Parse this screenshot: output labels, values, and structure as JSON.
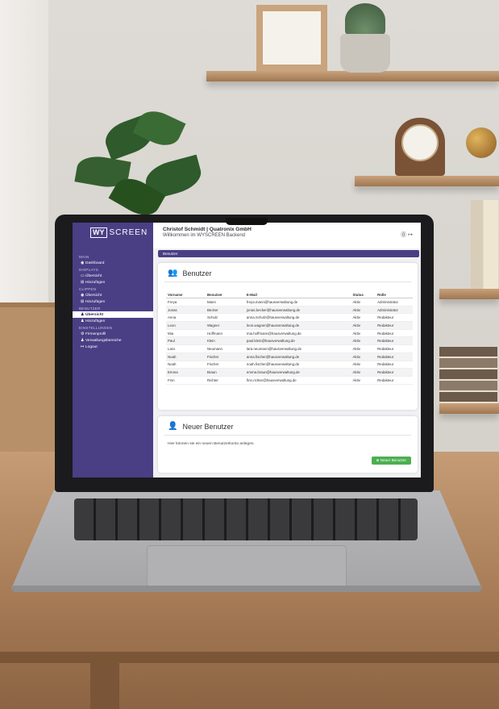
{
  "app": {
    "logo_box": "WY",
    "logo_rest": "SCREEN",
    "title": "Christof Schmidt | Quatronix GmbH",
    "subtitle": "Willkommen im WYSCREEN Backend"
  },
  "topbar": {
    "help_icon": "help-circle-icon",
    "logout_icon": "logout-icon"
  },
  "sidebar": {
    "sections": [
      {
        "label": "MAIN",
        "items": [
          {
            "icon": "dashboard-icon",
            "label": "Dashboard"
          }
        ]
      },
      {
        "label": "DISPLAYS",
        "items": [
          {
            "icon": "monitor-icon",
            "label": "Übersicht"
          },
          {
            "icon": "plus-square-icon",
            "label": "Hinzufügen"
          }
        ]
      },
      {
        "label": "CLIPPEN",
        "items": [
          {
            "icon": "clip-icon",
            "label": "Übersicht"
          },
          {
            "icon": "plus-square-icon",
            "label": "Hinzufügen"
          }
        ]
      },
      {
        "label": "BENUTZER",
        "items": [
          {
            "icon": "user-icon",
            "label": "Übersicht",
            "active": true
          },
          {
            "icon": "user-plus-icon",
            "label": "Hinzufügen"
          }
        ]
      },
      {
        "label": "EINSTELLUNGEN",
        "items": [
          {
            "icon": "gear-icon",
            "label": "Firmenprofil"
          },
          {
            "icon": "users-icon",
            "label": "Verwaltungsbereiche"
          },
          {
            "icon": "logout-icon",
            "label": "Logout"
          }
        ]
      }
    ]
  },
  "breadcrumb": "Benutzer",
  "users": {
    "heading": "Benutzer",
    "columns": [
      "Vorname",
      "Benutzer",
      "E-Mail",
      "Status",
      "Rolle"
    ],
    "rows": [
      [
        "Freya",
        "Mann",
        "freya.mann@hausverwaltung.de",
        "Aktiv",
        "Administrator"
      ],
      [
        "Jonas",
        "Becker",
        "jonas.becker@hausverwaltung.de",
        "Aktiv",
        "Administrator"
      ],
      [
        "Anna",
        "Schulz",
        "anna.Schulz@hausverwaltung.de",
        "Aktiv",
        "Redakteur"
      ],
      [
        "Leon",
        "Wagner",
        "leon.wagner@hausverwaltung.de",
        "Aktiv",
        "Redakteur"
      ],
      [
        "Mia",
        "Hoffmann",
        "mia.hoffmann@hausverwaltung.de",
        "Aktiv",
        "Redakteur"
      ],
      [
        "Paul",
        "Klein",
        "paul.klein@hausverwaltung.de",
        "Aktiv",
        "Redakteur"
      ],
      [
        "Lara",
        "Neumann",
        "lara.neumann@hausverwaltung.de",
        "Aktiv",
        "Redakteur"
      ],
      [
        "Noah",
        "Fischer",
        "anna.fischer@hausverwaltung.de",
        "Aktiv",
        "Redakteur"
      ],
      [
        "Noah",
        "Fischer",
        "noah.fischer@hausverwaltung.de",
        "Aktiv",
        "Redakteur"
      ],
      [
        "Emma",
        "Braun",
        "emma.braun@hausverwaltung.de",
        "Aktiv",
        "Redakteur"
      ],
      [
        "Finn",
        "Richter",
        "finn.richter@hausverwaltung.de",
        "Aktiv",
        "Redakteur"
      ]
    ]
  },
  "new_user": {
    "heading": "Neuer Benutzer",
    "text": "Hier können sie ein neuen Benutzerkonto anlegen.",
    "button": "Neuer Benutzer"
  },
  "colors": {
    "brand": "#4a3f85",
    "success": "#4caf50"
  }
}
